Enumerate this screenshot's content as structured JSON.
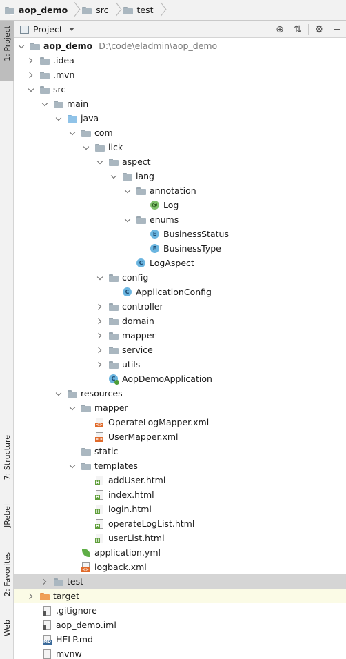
{
  "breadcrumb": [
    {
      "label": "aop_demo",
      "icon": "module-folder-icon",
      "bold": true
    },
    {
      "label": "src",
      "icon": "folder-icon",
      "bold": false
    },
    {
      "label": "test",
      "icon": "folder-icon",
      "bold": false
    }
  ],
  "left_stripe": {
    "project_tab": "1: Project",
    "structure_tab": "7: Structure",
    "jrebel_tab": "JRebel",
    "favorites_tab": "2: Favorites",
    "web_tab": "Web"
  },
  "project_panel": {
    "title": "Project",
    "tools": [
      "locate-icon",
      "collapse-all-icon",
      "settings-icon",
      "hide-icon"
    ]
  },
  "tree": {
    "root_label": "aop_demo",
    "root_path": "D:\\code\\eladmin\\aop_demo",
    "idea": ".idea",
    "mvn": ".mvn",
    "src": "src",
    "main": "main",
    "java": "java",
    "com": "com",
    "lick": "lick",
    "aspect": "aspect",
    "lang": "lang",
    "annotation": "annotation",
    "log": "Log",
    "enums": "enums",
    "business_status": "BusinessStatus",
    "business_type": "BusinessType",
    "log_aspect": "LogAspect",
    "config": "config",
    "application_config": "ApplicationConfig",
    "controller": "controller",
    "domain": "domain",
    "mapper_pkg": "mapper",
    "service": "service",
    "utils": "utils",
    "aop_demo_application": "AopDemoApplication",
    "resources": "resources",
    "mapper_res": "mapper",
    "operate_log_mapper": "OperateLogMapper.xml",
    "user_mapper": "UserMapper.xml",
    "static": "static",
    "templates": "templates",
    "add_user": "addUser.html",
    "index": "index.html",
    "login": "login.html",
    "operate_log_list": "operateLogList.html",
    "user_list": "userList.html",
    "application_yml": "application.yml",
    "logback": "logback.xml",
    "test": "test",
    "target": "target",
    "gitignore": ".gitignore",
    "iml": "aop_demo.iml",
    "help": "HELP.md",
    "mvnw": "mvnw"
  },
  "icon_letters": {
    "class": "C",
    "enum": "E",
    "annotation": "@",
    "html": "H",
    "xml": "<>",
    "md": "MD"
  }
}
